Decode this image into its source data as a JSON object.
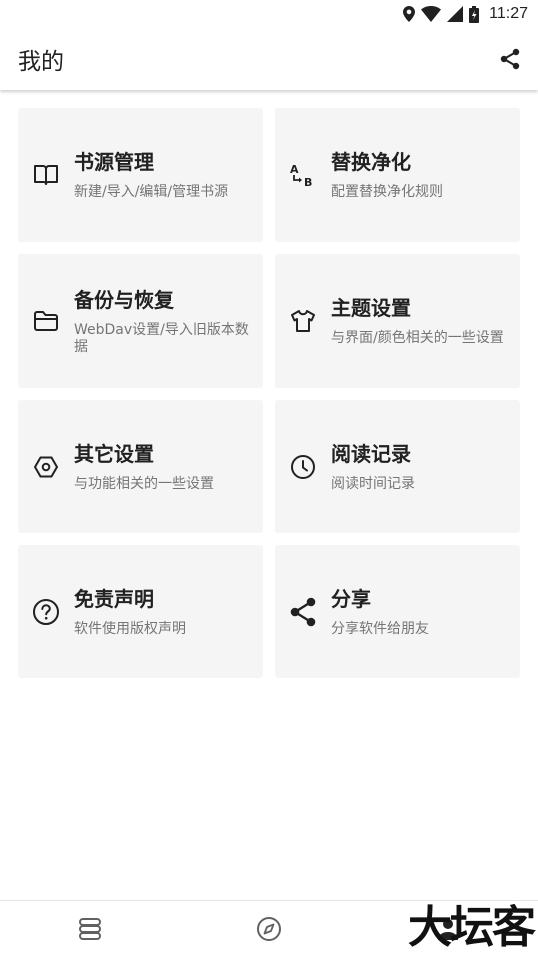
{
  "status_bar": {
    "time": "11:27",
    "icons": [
      "location-icon",
      "wifi-icon",
      "signal-icon",
      "battery-icon"
    ]
  },
  "app_bar": {
    "title": "我的",
    "action_icon": "share-icon"
  },
  "cards": [
    {
      "icon": "book-icon",
      "title": "书源管理",
      "desc": "新建/导入/编辑/管理书源"
    },
    {
      "icon": "replace-icon",
      "title": "替换净化",
      "desc": "配置替换净化规则"
    },
    {
      "icon": "folder-icon",
      "title": "备份与恢复",
      "desc": "WebDav设置/导入旧版本数据"
    },
    {
      "icon": "tshirt-icon",
      "title": "主题设置",
      "desc": "与界面/颜色相关的一些设置"
    },
    {
      "icon": "hex-settings-icon",
      "title": "其它设置",
      "desc": "与功能相关的一些设置"
    },
    {
      "icon": "clock-icon",
      "title": "阅读记录",
      "desc": "阅读时间记录"
    },
    {
      "icon": "help-circle-icon",
      "title": "免责声明",
      "desc": "软件使用版权声明"
    },
    {
      "icon": "share-icon",
      "title": "分享",
      "desc": "分享软件给朋友"
    }
  ],
  "bottom_nav": {
    "items": [
      {
        "icon": "bookshelf-icon"
      },
      {
        "icon": "compass-icon"
      },
      {
        "icon": "person-icon"
      }
    ]
  },
  "watermark": {
    "text": "大坛客"
  },
  "colors": {
    "card_bg": "#f5f5f5",
    "text_primary": "#212121",
    "text_secondary": "#757575"
  }
}
